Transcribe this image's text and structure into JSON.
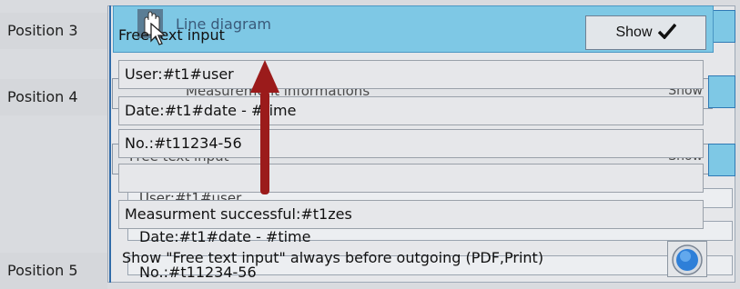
{
  "positions": [
    "Position 3",
    "Position 4",
    "Position 5"
  ],
  "background": {
    "title": "Line diagram",
    "measurement_label": "Measurement informations",
    "show_label": "Show",
    "free_text_label": "Free text input",
    "fields": [
      "User:#t1#user",
      "Date:#t1#date - #time",
      "No.:#t11234-56"
    ]
  },
  "overlay": {
    "title": "Free text input",
    "show_button": "Show",
    "fields": [
      "User:#t1#user",
      "Date:#t1#date - #time",
      "No.:#t11234-56",
      "",
      "Measurment successful:#t1zes"
    ],
    "date_line": "Date:#t1#date - #time",
    "option_text": "Show \"Free text input\" always before outgoing (PDF,Print)",
    "no_line": "No.:#t11234-56"
  },
  "colors": {
    "accent": "#7ec8e5",
    "arrow": "#9b1b1b"
  },
  "icons": [
    "hand-icon",
    "checkmark-icon",
    "radio-icon",
    "arrow-up-icon",
    "cursor-icon"
  ]
}
